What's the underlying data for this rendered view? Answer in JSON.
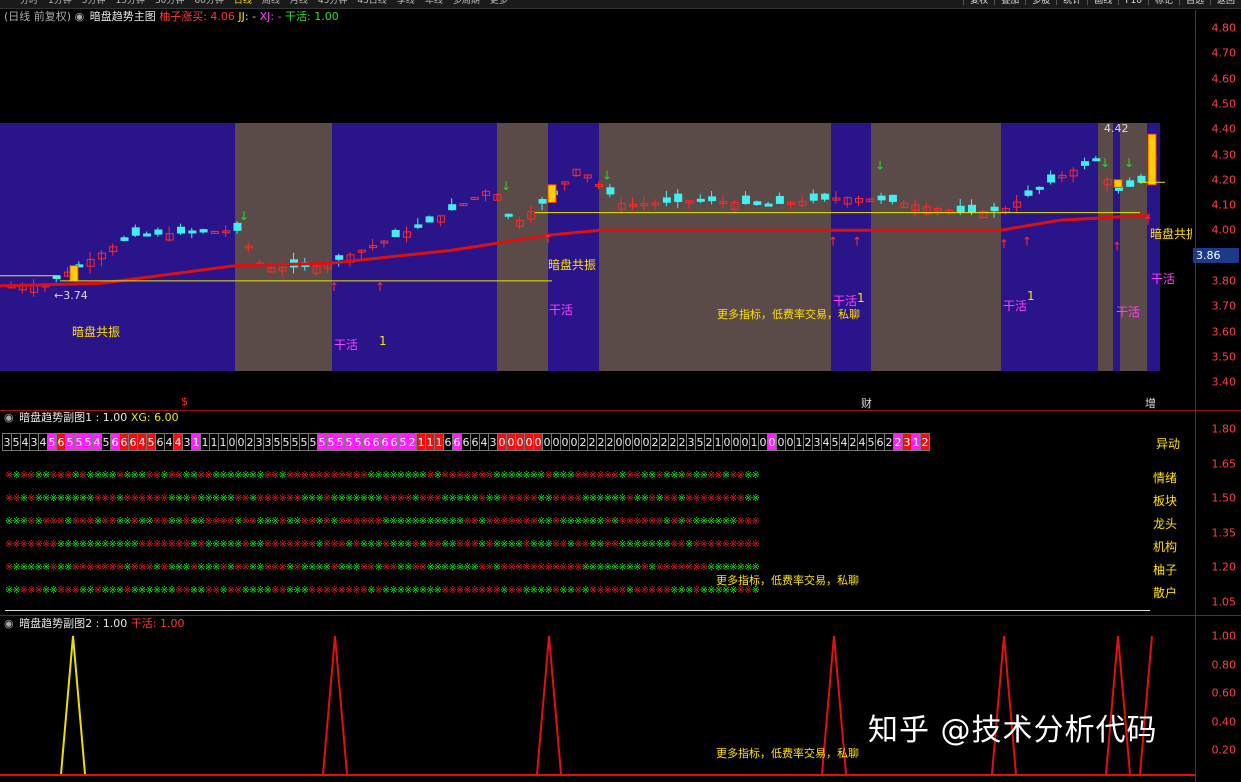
{
  "topbar": {
    "left_items": [
      "分时",
      "1分钟",
      "5分钟",
      "15分钟",
      "30分钟",
      "60分钟",
      "日线",
      "周线",
      "月线",
      "45分钟",
      "45日线",
      "季线",
      "年线",
      "多周期",
      "更多"
    ],
    "right_items": [
      "复权",
      "叠加",
      "多股",
      "统计",
      "画线",
      "F10",
      "标记",
      "自选",
      "返回"
    ]
  },
  "main_panel": {
    "title_prefix": "(日线 前复权)",
    "title": "暗盘趋势主图",
    "ind_label": "柚子涨买:",
    "ind_value": "4.06",
    "jj": "JJ: -",
    "xj": "XJ: -",
    "gan_label": "干活:",
    "gan_value": "1.00",
    "annotations": {
      "low_price": "←3.74",
      "high_price": "4.42",
      "dark_resonance_1": "暗盘共振",
      "dark_resonance_2": "暗盘共振",
      "dark_resonance_3": "暗盘共振",
      "work_1": "干活",
      "work_2": "干活",
      "work_3": "干活",
      "work_4": "干活",
      "work_5": "干活",
      "work_6": "干活",
      "one_1": "1",
      "one_2": "1",
      "one_3": "1",
      "promo": "更多指标，低费率交易，私聊",
      "marker_s": "$",
      "marker_cai": "财",
      "marker_zeng": "增"
    },
    "axis": [
      "4.80",
      "4.70",
      "4.60",
      "4.50",
      "4.40",
      "4.30",
      "4.20",
      "4.10",
      "4.00",
      "3.90",
      "3.80",
      "3.70",
      "3.60",
      "3.50",
      "3.40"
    ],
    "current_price": "3.86",
    "colors": {
      "band_blue": "#2a148a",
      "band_gray": "#5a4a48",
      "ma_line": "#dd1010",
      "up": "#ff2a2a",
      "down": "#40f0f0"
    }
  },
  "sub1": {
    "title": "暗盘趋势副图1",
    "v1": ": 1.00",
    "xg": "XG: 6.00",
    "numbers": "3543456555456664564431111002335555555555666652111666643000000000222200002222352100010000123454245622312",
    "number_row_label": "异动",
    "row_labels": [
      "情绪",
      "板块",
      "龙头",
      "机构",
      "柚子",
      "散户"
    ],
    "promo": "更多指标，低费率交易，私聊",
    "axis": [
      "1.80",
      "1.65",
      "1.50",
      "1.35",
      "1.20",
      "1.05"
    ]
  },
  "sub2": {
    "title": "暗盘趋势副图2",
    "v1": ": 1.00",
    "gan": "干活: 1.00",
    "promo": "更多指标，低费率交易，私聊",
    "axis": [
      "1.00",
      "0.80",
      "0.60",
      "0.40",
      "0.20"
    ]
  },
  "watermark": "知乎 @技术分析代码"
}
